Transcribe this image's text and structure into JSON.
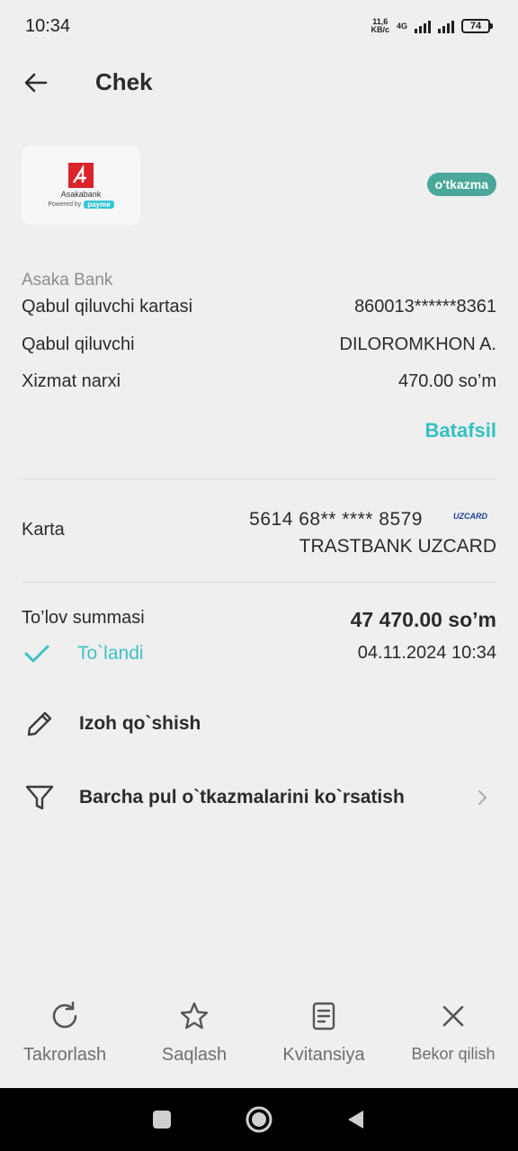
{
  "status_bar": {
    "time": "10:34",
    "speed_value": "11,6",
    "speed_unit": "KB/c",
    "network": "4G",
    "battery": "74"
  },
  "header": {
    "title": "Chek",
    "back_icon": "arrow-left-icon"
  },
  "merchant": {
    "logo_name": "Asakabank",
    "powered_by": "Powered by",
    "powered_brand": "payme",
    "type_badge": "o'tkazma"
  },
  "details": {
    "bank_name": "Asaka Bank",
    "rows": [
      {
        "label": "Qabul qiluvchi kartasi",
        "value": "860013******8361"
      },
      {
        "label": "Qabul qiluvchi",
        "value": "DILOROMKHON A."
      },
      {
        "label": "Xizmat narxi",
        "value": "470.00 so’m"
      }
    ],
    "more_link": "Batafsil"
  },
  "card": {
    "label": "Karta",
    "number": "5614 68** **** 8579",
    "network_logo": "UZCARD",
    "bank": "TRASTBANK UZCARD"
  },
  "payment": {
    "amount_label": "To’lov summasi",
    "amount": "47 470.00 so’m",
    "status": "To`landi",
    "datetime": "04.11.2024 10:34"
  },
  "actions": [
    {
      "label": "Izoh qo`shish",
      "icon": "pencil-icon"
    },
    {
      "label": "Barcha pul o`tkazmalarini ko`rsatish",
      "icon": "filter-icon"
    }
  ],
  "bottom_bar": [
    {
      "label": "Takrorlash",
      "icon": "refresh-icon"
    },
    {
      "label": "Saqlash",
      "icon": "star-icon"
    },
    {
      "label": "Kvitansiya",
      "icon": "receipt-icon"
    },
    {
      "label": "Bekor qilish",
      "icon": "close-icon"
    }
  ],
  "colors": {
    "accent": "#35c0c0",
    "badge": "#49a89a",
    "background": "#efeff0"
  }
}
